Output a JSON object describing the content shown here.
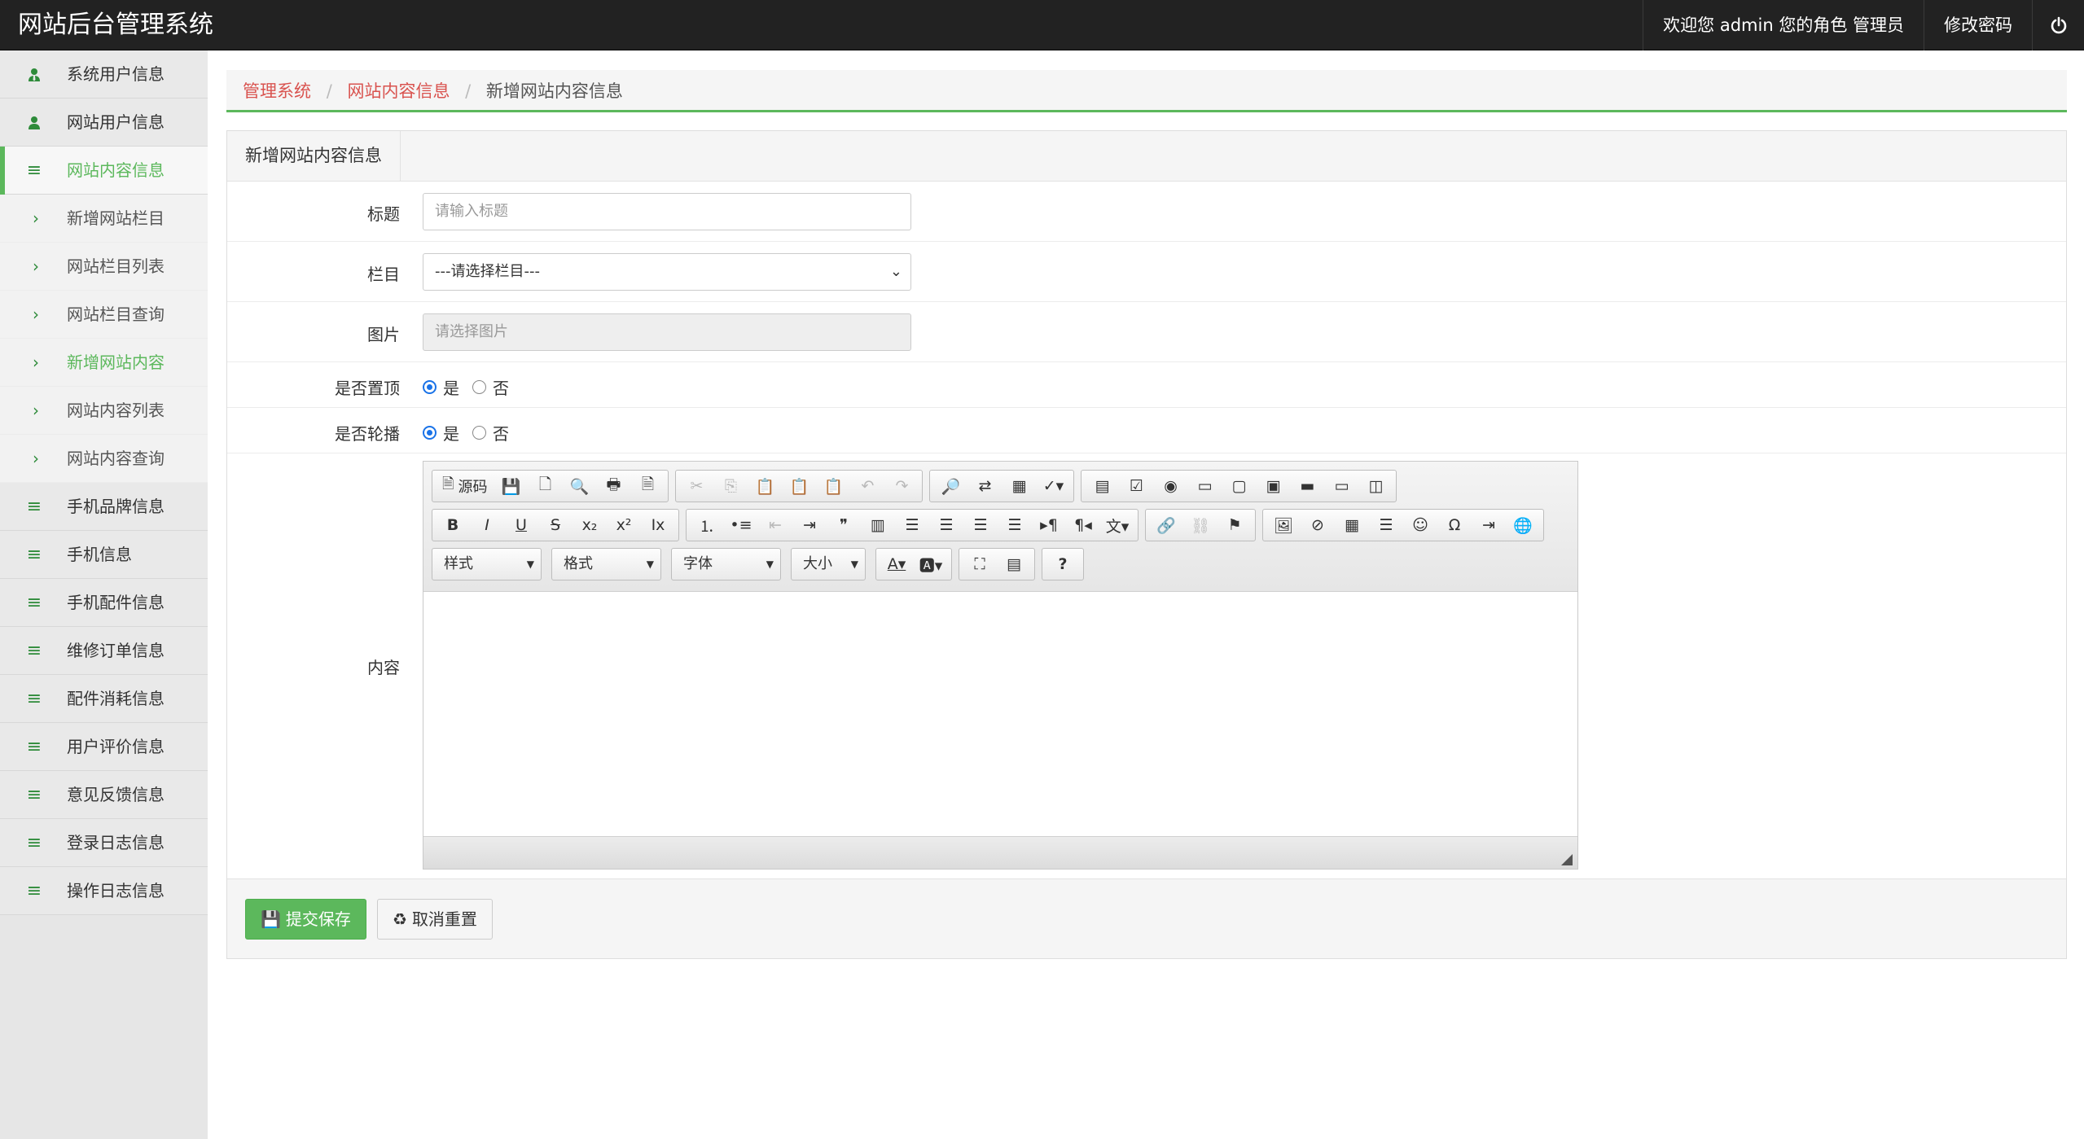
{
  "header": {
    "brand": "网站后台管理系统",
    "welcome": "欢迎您 admin 您的角色 管理员",
    "change_password": "修改密码",
    "power_icon": "power-icon"
  },
  "sidebar": {
    "items": [
      {
        "label": "系统用户信息",
        "icon": "user-tie-icon"
      },
      {
        "label": "网站用户信息",
        "icon": "user-icon"
      },
      {
        "label": "网站内容信息",
        "icon": "bars-icon",
        "active": true
      },
      {
        "label": "新增网站栏目",
        "icon": "chevron-right-icon",
        "sub": true
      },
      {
        "label": "网站栏目列表",
        "icon": "chevron-right-icon",
        "sub": true
      },
      {
        "label": "网站栏目查询",
        "icon": "chevron-right-icon",
        "sub": true
      },
      {
        "label": "新增网站内容",
        "icon": "chevron-right-icon",
        "sub": true,
        "current": true
      },
      {
        "label": "网站内容列表",
        "icon": "chevron-right-icon",
        "sub": true
      },
      {
        "label": "网站内容查询",
        "icon": "chevron-right-icon",
        "sub": true
      },
      {
        "label": "手机品牌信息",
        "icon": "bars-icon"
      },
      {
        "label": "手机信息",
        "icon": "bars-icon"
      },
      {
        "label": "手机配件信息",
        "icon": "bars-icon"
      },
      {
        "label": "维修订单信息",
        "icon": "bars-icon"
      },
      {
        "label": "配件消耗信息",
        "icon": "bars-icon"
      },
      {
        "label": "用户评价信息",
        "icon": "bars-icon"
      },
      {
        "label": "意见反馈信息",
        "icon": "bars-icon"
      },
      {
        "label": "登录日志信息",
        "icon": "bars-icon"
      },
      {
        "label": "操作日志信息",
        "icon": "bars-icon"
      }
    ]
  },
  "breadcrumb": {
    "items": [
      "管理系统",
      "网站内容信息"
    ],
    "current": "新增网站内容信息",
    "separator": "/"
  },
  "form": {
    "panel_title": "新增网站内容信息",
    "title_label": "标题",
    "title_placeholder": "请输入标题",
    "column_label": "栏目",
    "column_selected": "---请选择栏目---",
    "image_label": "图片",
    "image_placeholder": "请选择图片",
    "top_label": "是否置顶",
    "carousel_label": "是否轮播",
    "yes": "是",
    "no": "否",
    "top_value": "是",
    "carousel_value": "是",
    "content_label": "内容"
  },
  "editor": {
    "source_label": "源码",
    "combos": [
      "样式",
      "格式",
      "字体",
      "大小"
    ]
  },
  "actions": {
    "submit": "提交保存",
    "reset": "取消重置"
  },
  "colors": {
    "accent": "#5cb85c",
    "breadcrumb_link": "#d9534f",
    "header_bg": "#222222",
    "sidebar_bg": "#e6e6e6"
  }
}
